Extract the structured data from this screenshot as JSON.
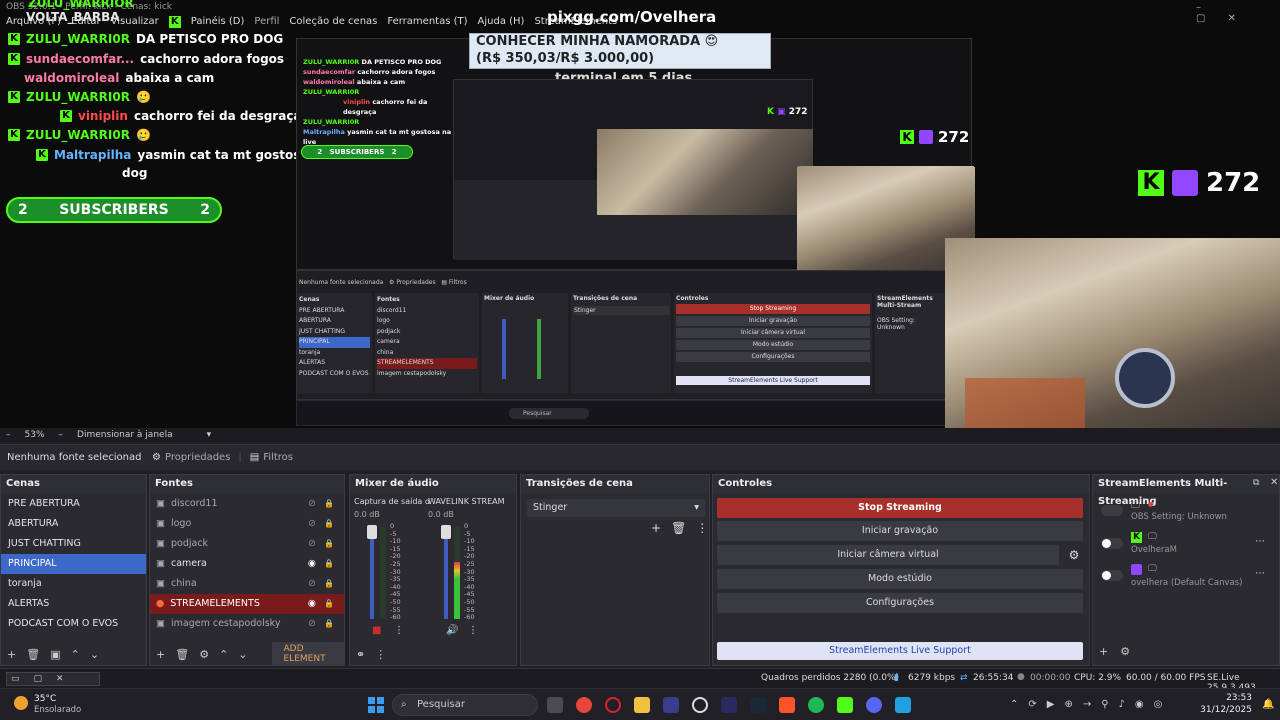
{
  "window": {
    "title": "OBS 32.0.1 - Perfil: kick - Cenas: kick"
  },
  "menu": [
    "Arquivo (F)",
    "Editar",
    "Visualizar",
    "Painéis (D)",
    "Perfil",
    "Coleção de cenas",
    "Ferramentas (T)",
    "Ajuda (H)",
    "StreamElements"
  ],
  "preview": {
    "banner_url": "pixgg.com/Ovelhera",
    "goal_text": "CONHECER MINHA NAMORADA 😍",
    "goal_amount": "(R$ 350,03/R$ 3.000,00)",
    "overlay_ghost": "terminal em 5 dias",
    "viewer_count": "272",
    "viewer_count_small": "272",
    "top_partial_user": "ZULU_WARRIOR",
    "top_partial_user2": "VOLTA_BARBA",
    "chat": [
      {
        "user": "ZULU_WARRI0R",
        "msg": "DA PETISCO PRO DOG",
        "color": "green",
        "badge": true
      },
      {
        "user": "sundaecomfar...",
        "msg": "cachorro adora fogos",
        "color": "pink",
        "badge": true
      },
      {
        "user": "waldomiroleal",
        "msg": "abaixa a cam",
        "color": "pink",
        "badge": false
      },
      {
        "user": "ZULU_WARRI0R",
        "msg": "🥲",
        "color": "green",
        "badge": true
      },
      {
        "user": "viniplin",
        "msg": "cachorro fei da desgraça",
        "color": "red",
        "badge": true
      },
      {
        "user": "ZULU_WARRI0R",
        "msg": "🥲",
        "color": "green",
        "badge": true
      },
      {
        "user": "Maltrapilha",
        "msg": "yasmin cat ta mt gostosa na live",
        "msg2": "dog",
        "color": "blue",
        "badge": true
      }
    ],
    "subs": {
      "left": "2",
      "label": "SUBSCRIBERS",
      "right": "2"
    }
  },
  "scalebar": {
    "zoom": "53%",
    "fit_label": "Dimensionar à janela"
  },
  "propbar": {
    "no_source": "Nenhuma fonte selecionad",
    "properties": "Propriedades",
    "filters": "Filtros"
  },
  "scenes": {
    "title": "Cenas",
    "items": [
      "PRE ABERTURA",
      "ABERTURA",
      "JUST CHATTING",
      "PRINCIPAL",
      "toranja",
      "ALERTAS",
      "PODCAST COM O EVOS"
    ],
    "selected": 3
  },
  "sources": {
    "title": "Fontes",
    "items": [
      {
        "name": "discord11",
        "visible": false,
        "locked": true
      },
      {
        "name": "logo",
        "visible": false,
        "locked": true
      },
      {
        "name": "podjack",
        "visible": false,
        "locked": true
      },
      {
        "name": "camera",
        "visible": true,
        "locked": true
      },
      {
        "name": "china",
        "visible": false,
        "locked": true
      },
      {
        "name": "STREAMELEMENTS",
        "visible": true,
        "locked": true,
        "selected": true
      },
      {
        "name": "imagem cestapodolsky",
        "visible": false,
        "locked": true
      }
    ],
    "add_element": "ADD ELEMENT"
  },
  "mixer": {
    "title": "Mixer de áudio",
    "channels": [
      {
        "name": "Captura de saída d",
        "db": "0.0 dB",
        "level": 0.0
      },
      {
        "name": "WAVELINK STREAM",
        "db": "0.0 dB",
        "level": 0.62
      }
    ],
    "scale": [
      "0",
      "-5",
      "-10",
      "-15",
      "-20",
      "-25",
      "-30",
      "-35",
      "-40",
      "-45",
      "-50",
      "-55",
      "-60"
    ]
  },
  "transitions": {
    "title": "Transições de cena",
    "selected": "Stinger"
  },
  "controls": {
    "title": "Controles",
    "stop_streaming": "Stop Streaming",
    "start_recording": "Iniciar gravação",
    "virtual_camera": "Iniciar câmera virtual",
    "studio_mode": "Modo estúdio",
    "settings": "Configurações",
    "live_support": "StreamElements Live Support"
  },
  "multistream": {
    "title": "StreamElements Multi-Streaming",
    "obs_setting": "OBS Setting: Unknown",
    "targets": [
      {
        "platform": "kick",
        "name": "OvelheraM"
      },
      {
        "platform": "twitch",
        "name": "ovelhera (Default Canvas)"
      }
    ]
  },
  "status": {
    "frames_dropped": "Quadros perdidos 2280 (0.0%)",
    "bitrate": "6279 kbps",
    "stream_time": "26:55:34",
    "rec_time": "00:00:00",
    "cpu": "CPU: 2.9%",
    "fps": "60.00 / 60.00 FPS",
    "version": "SE.Live 25.9.3.493"
  },
  "taskbar": {
    "temp": "35°C",
    "weather": "Ensolarado",
    "search": "Pesquisar",
    "time": "23:53",
    "date": "31/12/2025"
  },
  "colors": {
    "accent_blue": "#3c68c8",
    "stop_red": "#a8302a",
    "kick_green": "#53fc18",
    "twitch_purple": "#9146ff"
  }
}
